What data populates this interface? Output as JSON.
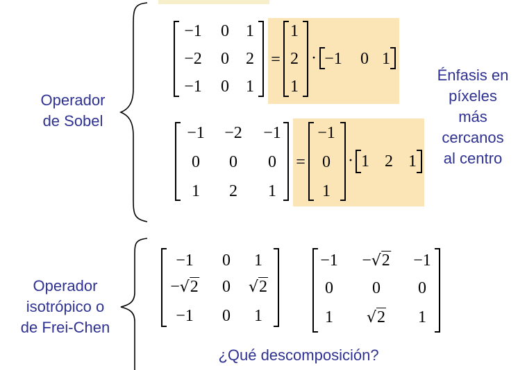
{
  "sobel": {
    "label": "Operador\nde Sobel",
    "gx": [
      [
        "−1",
        "0",
        "1"
      ],
      [
        "−2",
        "0",
        "2"
      ],
      [
        "−1",
        "0",
        "1"
      ]
    ],
    "gx_col": [
      "1",
      "2",
      "1"
    ],
    "gx_row": [
      "−1",
      "0",
      "1"
    ],
    "gy": [
      [
        "−1",
        "−2",
        "−1"
      ],
      [
        "0",
        "0",
        "0"
      ],
      [
        "1",
        "2",
        "1"
      ]
    ],
    "gy_col": [
      "−1",
      "0",
      "1"
    ],
    "gy_row": [
      "1",
      "2",
      "1"
    ],
    "equals": "=",
    "dot": "·"
  },
  "emphasis": {
    "text": "Énfasis en\npíxeles\nmás\ncercanos\nal centro"
  },
  "freichen": {
    "label": "Operador\nisotrópico o\nde Frei-Chen",
    "m1": [
      [
        "−1",
        "0",
        "1"
      ],
      [
        "−√2",
        "0",
        "√2"
      ],
      [
        "−1",
        "0",
        "1"
      ]
    ],
    "m2": [
      [
        "−1",
        "−√2",
        "−1"
      ],
      [
        "0",
        "0",
        "0"
      ],
      [
        "1",
        "√2",
        "1"
      ]
    ],
    "question": "¿Qué descomposición?"
  },
  "colors": {
    "label_text": "#2e3192",
    "highlight": "#fbe5b6"
  }
}
